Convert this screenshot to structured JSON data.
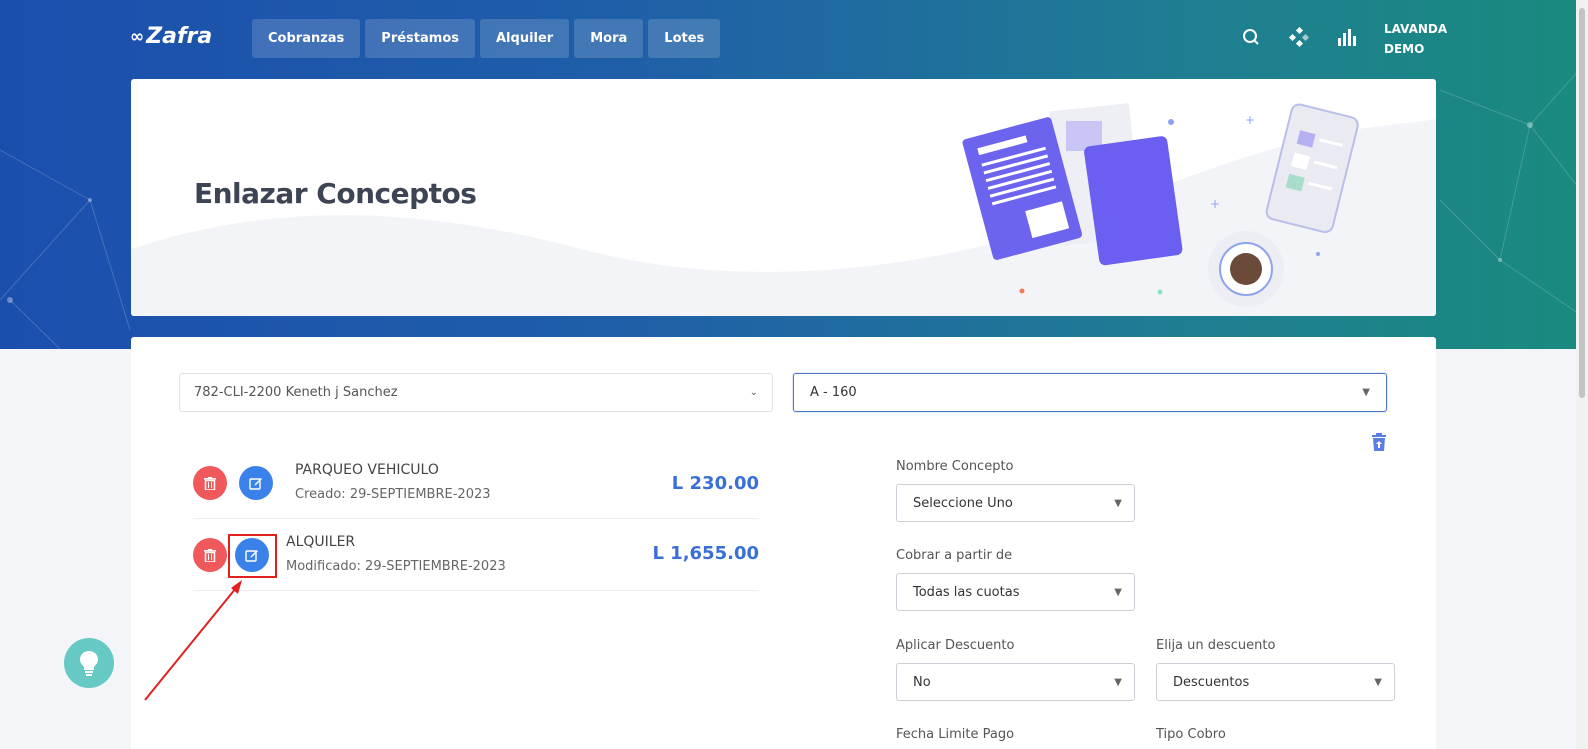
{
  "app": {
    "logo": "Zafra"
  },
  "nav": [
    {
      "label": "Cobranzas"
    },
    {
      "label": "Préstamos"
    },
    {
      "label": "Alquiler"
    },
    {
      "label": "Mora"
    },
    {
      "label": "Lotes"
    }
  ],
  "user": {
    "line1": "LAVANDA",
    "line2": "DEMO"
  },
  "banner": {
    "title": "Enlazar Conceptos"
  },
  "filters": {
    "client": "782-CLI-2200 Keneth j Sanchez",
    "lot": "A - 160"
  },
  "items": [
    {
      "title": "PARQUEO VEHICULO",
      "sub": "Creado: 29-SEPTIEMBRE-2023",
      "amount": "L 230.00"
    },
    {
      "title": "ALQUILER",
      "sub": "Modificado: 29-SEPTIEMBRE-2023",
      "amount": "L 1,655.00"
    }
  ],
  "form": {
    "nombre_concepto": {
      "label": "Nombre Concepto",
      "value": "Seleccione Uno"
    },
    "cobrar_desde": {
      "label": "Cobrar a partir de",
      "value": "Todas las cuotas"
    },
    "aplicar_descuento": {
      "label": "Aplicar Descuento",
      "value": "No"
    },
    "elija_descuento": {
      "label": "Elija un descuento",
      "value": "Descuentos"
    },
    "fecha_limite": {
      "label": "Fecha Limite Pago"
    },
    "tipo_cobro": {
      "label": "Tipo Cobro"
    }
  },
  "colors": {
    "primary": "#3a82ea",
    "danger": "#f0595b",
    "amount": "#3a6fd8",
    "highlight": "#e12020"
  },
  "icons": [
    "search-icon",
    "apps-icon",
    "stats-icon",
    "trash-icon",
    "edit-icon",
    "lightbulb-icon",
    "chevron-down-icon"
  ]
}
